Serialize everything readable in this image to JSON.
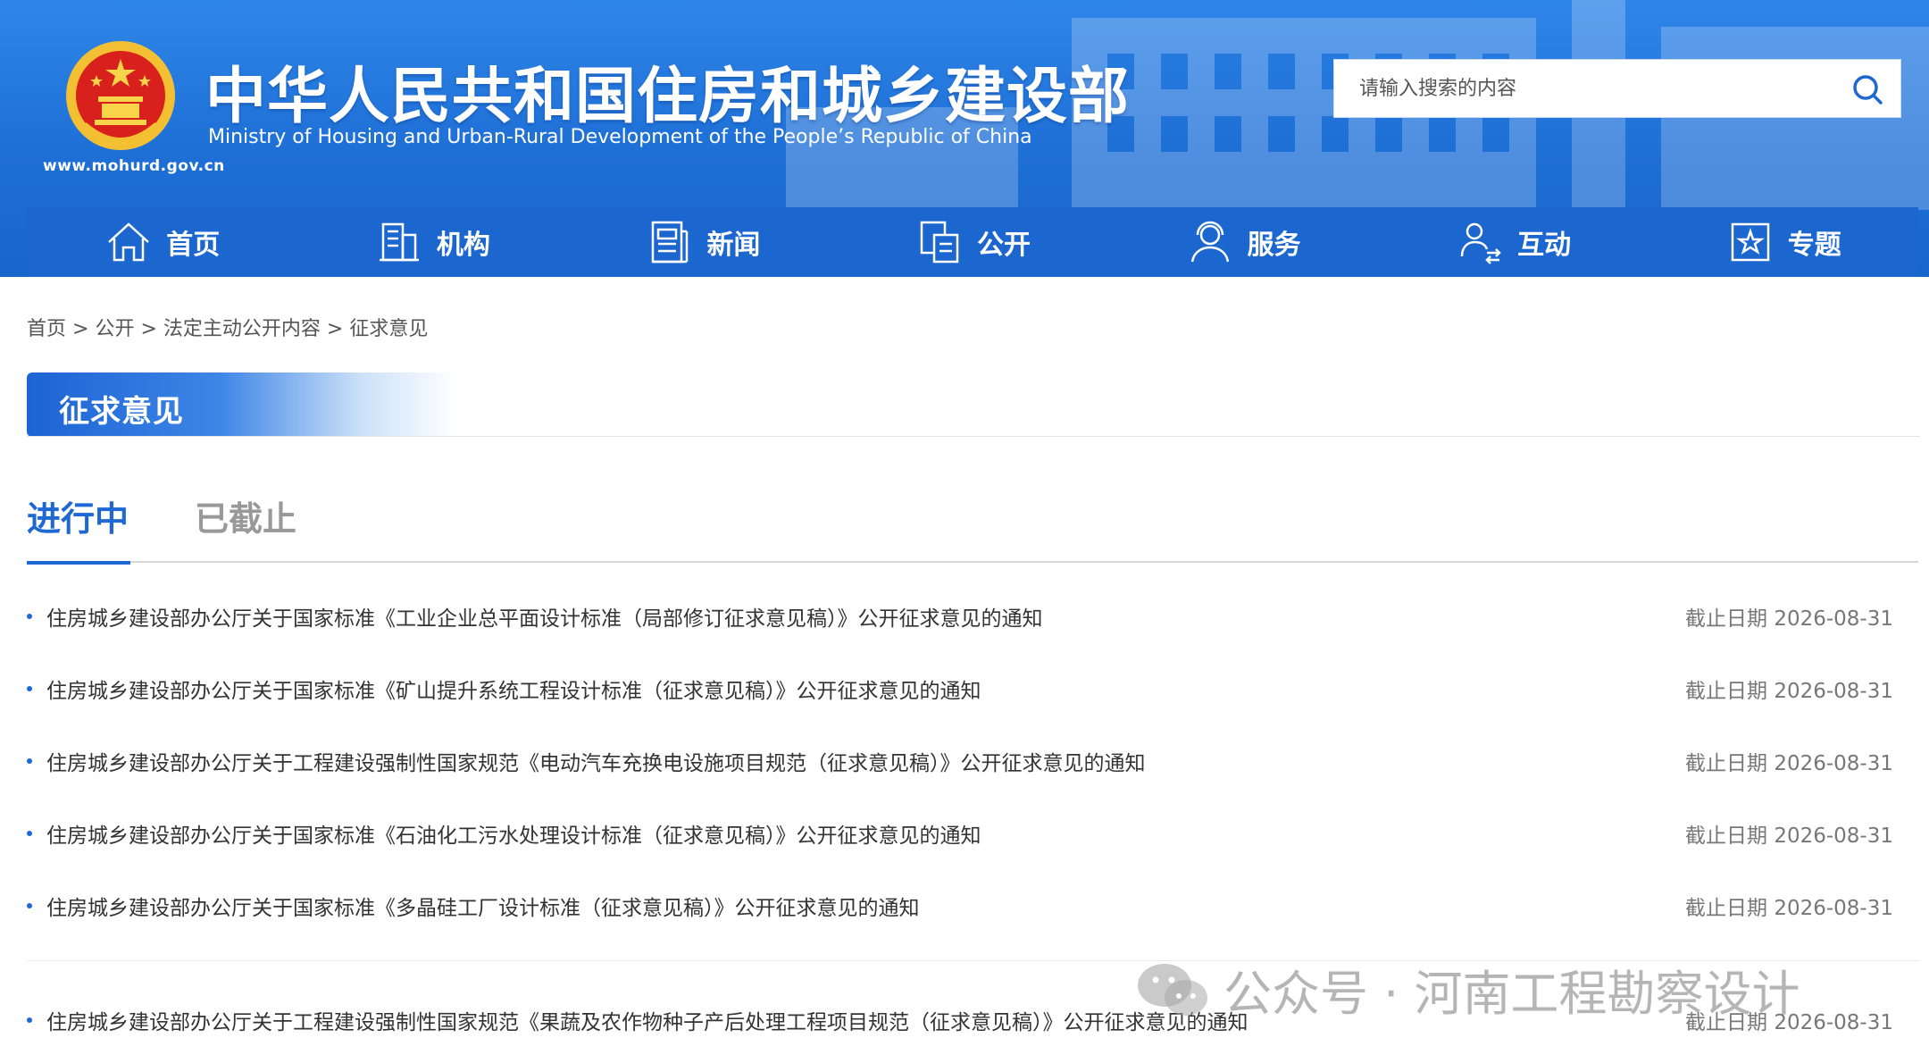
{
  "header": {
    "title": "中华人民共和国住房和城乡建设部",
    "subtitle": "Ministry of Housing and Urban-Rural Development of the People’s Republic of China",
    "url": "www.mohurd.gov.cn",
    "search_placeholder": "请输入搜索的内容"
  },
  "nav": [
    {
      "label": "首页",
      "icon": "home-icon"
    },
    {
      "label": "机构",
      "icon": "building-icon"
    },
    {
      "label": "新闻",
      "icon": "news-icon"
    },
    {
      "label": "公开",
      "icon": "disclosure-icon"
    },
    {
      "label": "服务",
      "icon": "service-icon"
    },
    {
      "label": "互动",
      "icon": "interaction-icon"
    },
    {
      "label": "专题",
      "icon": "topic-icon"
    }
  ],
  "breadcrumb": {
    "items": [
      "首页",
      "公开",
      "法定主动公开内容",
      "征求意见"
    ],
    "separator": ">"
  },
  "section": {
    "title": "征求意见"
  },
  "tabs": {
    "active": "进行中",
    "inactive": "已截止"
  },
  "notices": [
    {
      "title": "住房城乡建设部办公厅关于国家标准《工业企业总平面设计标准（局部修订征求意见稿）》公开征求意见的通知",
      "deadline": "截止日期 2026-08-31"
    },
    {
      "title": "住房城乡建设部办公厅关于国家标准《矿山提升系统工程设计标准（征求意见稿）》公开征求意见的通知",
      "deadline": "截止日期 2026-08-31"
    },
    {
      "title": "住房城乡建设部办公厅关于工程建设强制性国家规范《电动汽车充换电设施项目规范（征求意见稿）》公开征求意见的通知",
      "deadline": "截止日期 2026-08-31"
    },
    {
      "title": "住房城乡建设部办公厅关于国家标准《石油化工污水处理设计标准（征求意见稿）》公开征求意见的通知",
      "deadline": "截止日期 2026-08-31"
    },
    {
      "title": "住房城乡建设部办公厅关于国家标准《多晶硅工厂设计标准（征求意见稿）》公开征求意见的通知",
      "deadline": "截止日期 2026-08-31"
    },
    {
      "title": "住房城乡建设部办公厅关于工程建设强制性国家规范《果蔬及农作物种子产后处理工程项目规范（征求意见稿）》公开征求意见的通知",
      "deadline": "截止日期 2026-08-31"
    }
  ],
  "watermark": "公众号 · 河南工程勘察设计",
  "colors": {
    "brand_blue": "#1f68d3",
    "nav_blue": "#1c67cf",
    "header_blue": "#2f86e8"
  }
}
